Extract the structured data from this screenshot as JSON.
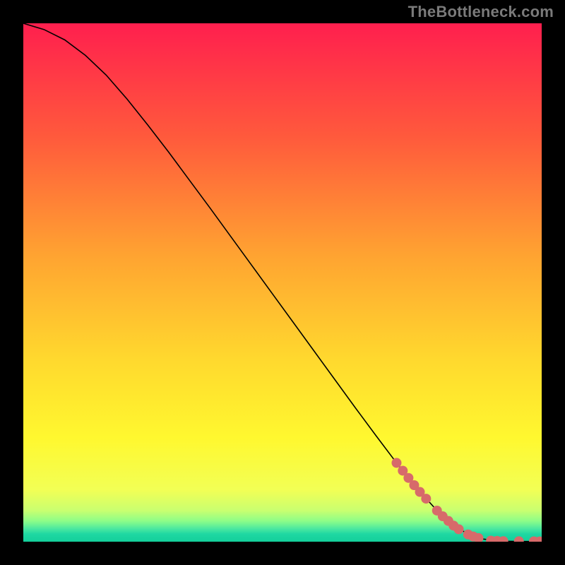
{
  "watermark": "TheBottleneck.com",
  "chart_data": {
    "type": "line",
    "title": "",
    "xlabel": "",
    "ylabel": "",
    "xlim": [
      0,
      100
    ],
    "ylim": [
      0,
      100
    ],
    "curve": {
      "name": "black-curve",
      "color": "#000000",
      "x": [
        0,
        4,
        8,
        12,
        16,
        20,
        24,
        28,
        32,
        36,
        40,
        44,
        48,
        52,
        56,
        60,
        64,
        68,
        72,
        76,
        80,
        84,
        88,
        92,
        96,
        100
      ],
      "y": [
        100,
        98.8,
        96.8,
        93.8,
        90.0,
        85.4,
        80.4,
        75.2,
        69.8,
        64.4,
        58.9,
        53.4,
        47.9,
        42.4,
        36.9,
        31.4,
        25.9,
        20.5,
        15.2,
        10.2,
        5.8,
        2.4,
        0.6,
        0.1,
        0.05,
        0.05
      ]
    },
    "markers": {
      "name": "red-markers",
      "color": "#d76a6a",
      "radius_px": 7,
      "points": [
        {
          "x": 72.0,
          "y": 15.2
        },
        {
          "x": 73.2,
          "y": 13.7
        },
        {
          "x": 74.3,
          "y": 12.3
        },
        {
          "x": 75.4,
          "y": 10.9
        },
        {
          "x": 76.5,
          "y": 9.6
        },
        {
          "x": 77.7,
          "y": 8.3
        },
        {
          "x": 79.8,
          "y": 6.0
        },
        {
          "x": 80.9,
          "y": 4.9
        },
        {
          "x": 82.0,
          "y": 4.0
        },
        {
          "x": 83.0,
          "y": 3.1
        },
        {
          "x": 84.0,
          "y": 2.4
        },
        {
          "x": 85.8,
          "y": 1.4
        },
        {
          "x": 86.8,
          "y": 1.0
        },
        {
          "x": 87.8,
          "y": 0.7
        },
        {
          "x": 90.2,
          "y": 0.2
        },
        {
          "x": 91.4,
          "y": 0.15
        },
        {
          "x": 92.6,
          "y": 0.1
        },
        {
          "x": 95.6,
          "y": 0.08
        },
        {
          "x": 98.5,
          "y": 0.06
        },
        {
          "x": 99.6,
          "y": 0.05
        }
      ]
    },
    "background_gradient": {
      "stops": [
        {
          "offset": 0.0,
          "color": "#ff1f4e"
        },
        {
          "offset": 0.22,
          "color": "#ff5a3c"
        },
        {
          "offset": 0.45,
          "color": "#ffa431"
        },
        {
          "offset": 0.65,
          "color": "#ffd92e"
        },
        {
          "offset": 0.8,
          "color": "#fff82f"
        },
        {
          "offset": 0.9,
          "color": "#f2ff55"
        },
        {
          "offset": 0.94,
          "color": "#c9ff70"
        },
        {
          "offset": 0.96,
          "color": "#8dfd88"
        },
        {
          "offset": 0.975,
          "color": "#4be8a0"
        },
        {
          "offset": 0.985,
          "color": "#1fd8a2"
        },
        {
          "offset": 1.0,
          "color": "#14cf9b"
        }
      ]
    }
  }
}
